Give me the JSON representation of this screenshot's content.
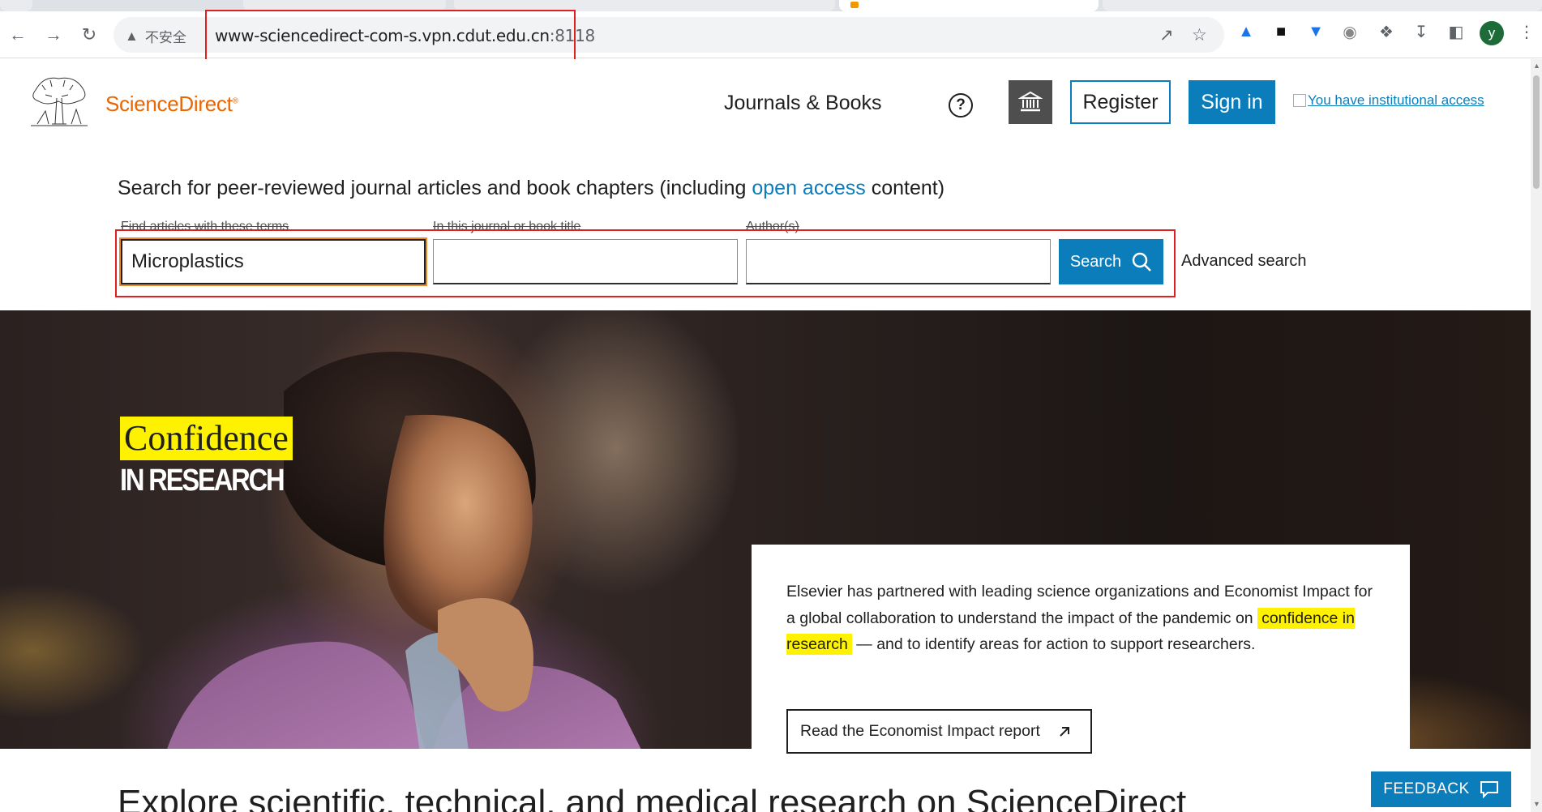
{
  "browser": {
    "security_label": "不安全",
    "url_host": "www-sciencedirect-com-s.vpn.cdut.edu.cn",
    "url_port": ":8118",
    "profile_initial": "y"
  },
  "header": {
    "logo_text": "ScienceDirect",
    "nav_journals": "Journals & Books",
    "help_symbol": "?",
    "register_label": "Register",
    "signin_label": "Sign in",
    "institutional_access": "You have institutional access"
  },
  "search": {
    "heading_prefix": "Search for peer-reviewed journal articles and book chapters (including ",
    "heading_link": "open access",
    "heading_suffix": " content)",
    "terms_label": "Find articles with these terms",
    "terms_value": "Microplastics",
    "journal_label": "In this journal or book title",
    "journal_value": "",
    "author_label": "Author(s)",
    "author_value": "",
    "search_button": "Search",
    "advanced_search": "Advanced search"
  },
  "hero": {
    "confidence": "Confidence",
    "in_research": "IN RESEARCH",
    "text_part1": "Elsevier has partnered with leading science organizations and Economist Impact for a global collaboration to understand the impact of the pandemic on ",
    "text_highlight": "confidence in research",
    "text_part2": " — and to identify areas for action to support researchers.",
    "report_button": "Read the Economist Impact report"
  },
  "explore_heading": "Explore scientific, technical, and medical research on ScienceDirect",
  "feedback_label": "FEEDBACK",
  "colors": {
    "brand_orange": "#eb6500",
    "primary_blue": "#0c7dbb",
    "highlight_yellow": "#fef200",
    "annotation_red": "#e0201f"
  }
}
